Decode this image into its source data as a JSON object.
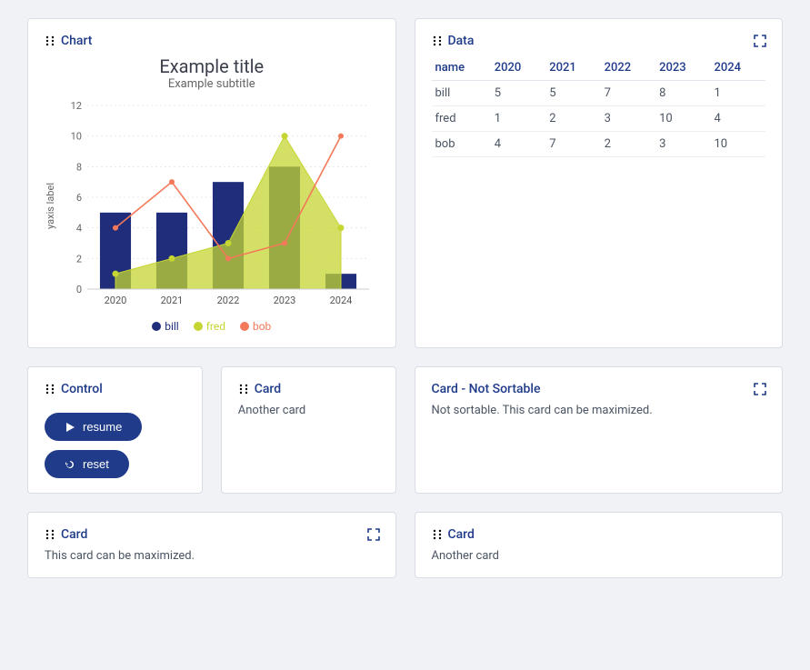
{
  "chart_data": {
    "type": "mixed",
    "title": "Example title",
    "subtitle": "Example subtitle",
    "xlabel": "",
    "ylabel": "yaxis label",
    "categories": [
      "2020",
      "2021",
      "2022",
      "2023",
      "2024"
    ],
    "y_ticks": [
      0,
      2,
      4,
      6,
      8,
      10,
      12
    ],
    "ylim": [
      0,
      12
    ],
    "series": [
      {
        "name": "bill",
        "type": "bar",
        "color": "#1f2d7a",
        "values": [
          5,
          5,
          7,
          8,
          1
        ]
      },
      {
        "name": "fred",
        "type": "area",
        "color": "#c5d531",
        "values": [
          1,
          2,
          3,
          10,
          4
        ]
      },
      {
        "name": "bob",
        "type": "line",
        "color": "#f3795a",
        "values": [
          4,
          7,
          2,
          3,
          10
        ]
      }
    ]
  },
  "cards": {
    "chart": {
      "title": "Chart"
    },
    "data": {
      "title": "Data",
      "columns": [
        "name",
        "2020",
        "2021",
        "2022",
        "2023",
        "2024"
      ],
      "rows": [
        [
          "bill",
          "5",
          "5",
          "7",
          "8",
          "1"
        ],
        [
          "fred",
          "1",
          "2",
          "3",
          "10",
          "4"
        ],
        [
          "bob",
          "4",
          "7",
          "2",
          "3",
          "10"
        ]
      ]
    },
    "control": {
      "title": "Control",
      "resume_label": "resume",
      "reset_label": "reset"
    },
    "card_a": {
      "title": "Card",
      "body": "Another card"
    },
    "card_ns": {
      "title": "Card - Not Sortable",
      "body": "Not sortable. This card can be maximized."
    },
    "card_max": {
      "title": "Card",
      "body": "This card can be maximized."
    },
    "card_b": {
      "title": "Card",
      "body": "Another card"
    }
  }
}
